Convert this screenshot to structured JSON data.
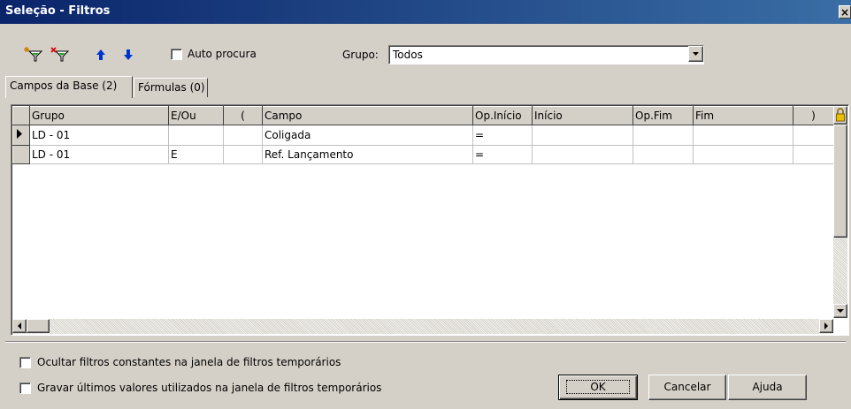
{
  "window": {
    "title": "Seleção - Filtros",
    "close_label": "×"
  },
  "toolbar": {
    "icons": [
      "add-filter-icon",
      "remove-filter-icon",
      "move-up-icon",
      "move-down-icon"
    ],
    "auto_search_label": "Auto procura",
    "auto_search_checked": false,
    "group_label": "Grupo:",
    "group_value": "Todos"
  },
  "tabs": [
    {
      "label": "Campos da Base (2)",
      "active": true
    },
    {
      "label": "Fórmulas (0)",
      "active": false
    }
  ],
  "grid": {
    "columns": [
      "Grupo",
      "E/Ou",
      "(",
      "Campo",
      "Op.Início",
      "Início",
      "Op.Fim",
      "Fim",
      ")"
    ],
    "rows": [
      {
        "current": true,
        "cells": [
          "LD - 01",
          "",
          "",
          "Coligada",
          "=",
          "",
          "",
          "",
          ""
        ]
      },
      {
        "current": false,
        "cells": [
          "LD - 01",
          "E",
          "",
          "Ref. Lançamento",
          "=",
          "",
          "",
          "",
          ""
        ]
      }
    ]
  },
  "options": {
    "hide_constant_label": "Ocultar filtros constantes na janela de filtros temporários",
    "save_last_label": "Gravar últimos valores utilizados na janela de filtros temporários"
  },
  "buttons": {
    "ok": "OK",
    "cancel": "Cancelar",
    "help": "Ajuda"
  },
  "colors": {
    "title_start": "#0a246a",
    "title_end": "#3a6ea5",
    "arrow_blue": "#0033cc"
  }
}
